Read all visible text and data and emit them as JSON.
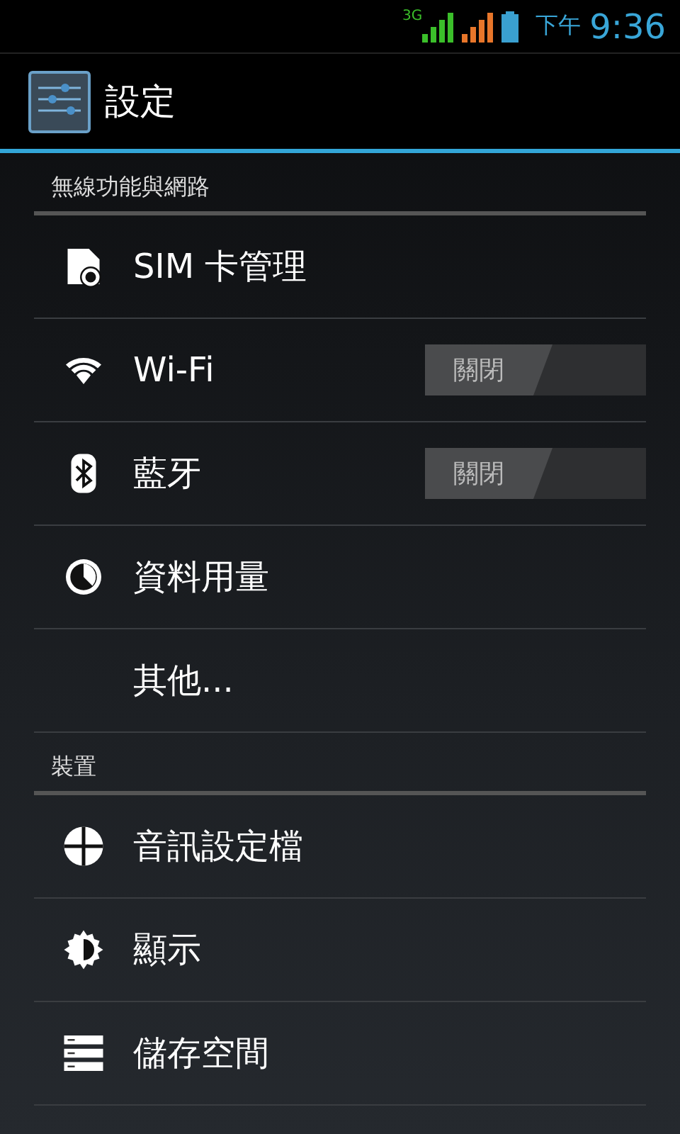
{
  "status_bar": {
    "network": "3G",
    "period": "下午",
    "time": "9:36"
  },
  "action_bar": {
    "title": "設定"
  },
  "sections": [
    {
      "header": "無線功能與網路",
      "items": [
        {
          "kind": "plain",
          "label": "SIM 卡管理"
        },
        {
          "kind": "switch",
          "label": "Wi-Fi",
          "switch_label": "關閉",
          "on": false
        },
        {
          "kind": "switch",
          "label": "藍牙",
          "switch_label": "關閉",
          "on": false
        },
        {
          "kind": "plain",
          "label": "資料用量"
        },
        {
          "kind": "plain",
          "label": "其他..."
        }
      ]
    },
    {
      "header": "裝置",
      "items": [
        {
          "kind": "plain",
          "label": "音訊設定檔"
        },
        {
          "kind": "plain",
          "label": "顯示"
        },
        {
          "kind": "plain",
          "label": "儲存空間"
        }
      ]
    }
  ]
}
